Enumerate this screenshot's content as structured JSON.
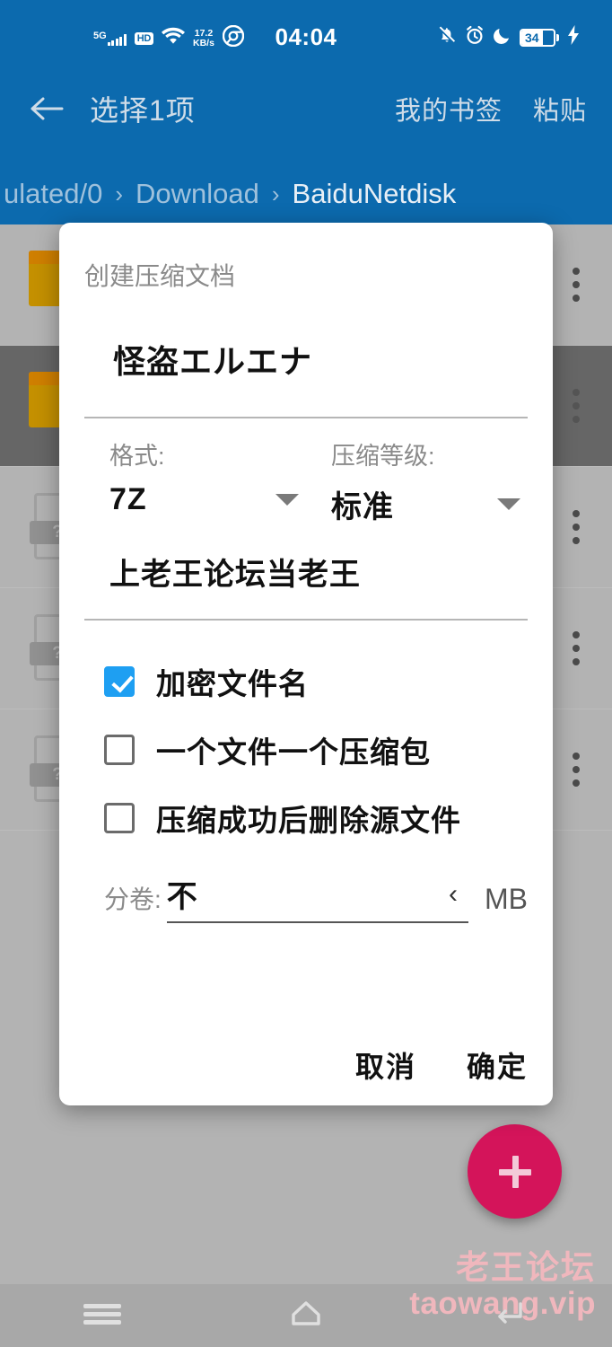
{
  "statusbar": {
    "network_type": "5G",
    "hd_label": "HD",
    "net_speed_value": "17.2",
    "net_speed_unit": "KB/s",
    "browser_icon": "chrome-icon",
    "clock": "04:04",
    "mute_icon": "bell-muted-icon",
    "alarm_icon": "alarm-clock-icon",
    "dnd_icon": "moon-icon",
    "battery_percent": "34",
    "charging_icon": "lightning-bolt-icon"
  },
  "toolbar": {
    "back_icon": "arrow-left-icon",
    "title": "选择1项",
    "action_bookmarks": "我的书签",
    "action_paste": "粘贴"
  },
  "breadcrumb": {
    "separator": "›",
    "items": [
      {
        "label": "ulated/0",
        "current": false
      },
      {
        "label": "Download",
        "current": false
      },
      {
        "label": "BaiduNetdisk",
        "current": true
      }
    ]
  },
  "filelist": {
    "rows": [
      {
        "type": "folder",
        "selected": false,
        "menu_icon": "overflow-menu-icon"
      },
      {
        "type": "folder",
        "selected": true,
        "menu_icon": "overflow-menu-icon"
      },
      {
        "type": "file",
        "selected": false,
        "badge": "?",
        "menu_icon": "overflow-menu-icon"
      },
      {
        "type": "file",
        "selected": false,
        "badge": "?",
        "menu_icon": "overflow-menu-icon"
      },
      {
        "type": "file",
        "selected": false,
        "badge": "?",
        "menu_icon": "overflow-menu-icon"
      }
    ]
  },
  "fab": {
    "icon": "plus-icon",
    "color": "#d4145a"
  },
  "watermark": {
    "line1": "老王论坛",
    "line2": "taowang.vip",
    "color": "#f0b7bd"
  },
  "navbar": {
    "recents_icon": "menu-icon",
    "home_icon": "home-icon",
    "back_icon": "back-arrow-icon"
  },
  "dialog": {
    "title": "创建压缩文档",
    "archive_name": "怪盗エルエナ",
    "format": {
      "label": "格式:",
      "value": "7Z",
      "caret_icon": "chevron-down-icon"
    },
    "level": {
      "label": "压缩等级:",
      "value": "标准",
      "caret_icon": "chevron-down-icon"
    },
    "password": {
      "value": "上老王论坛当老王"
    },
    "checkboxes": [
      {
        "label": "加密文件名",
        "checked": true
      },
      {
        "label": "一个文件一个压缩包",
        "checked": false
      },
      {
        "label": "压缩成功后删除源文件",
        "checked": false
      }
    ],
    "split": {
      "label": "分卷:",
      "value": "不",
      "chevron_icon": "chevron-left-icon",
      "chevron_glyph": "‹",
      "unit": "MB"
    },
    "buttons": {
      "cancel": "取消",
      "confirm": "确定"
    },
    "accent_color": "#1e9ff2"
  },
  "theme": {
    "header_blue": "#0c6aae",
    "background_gray": "#b3b3b3",
    "selected_row": "#666666"
  }
}
